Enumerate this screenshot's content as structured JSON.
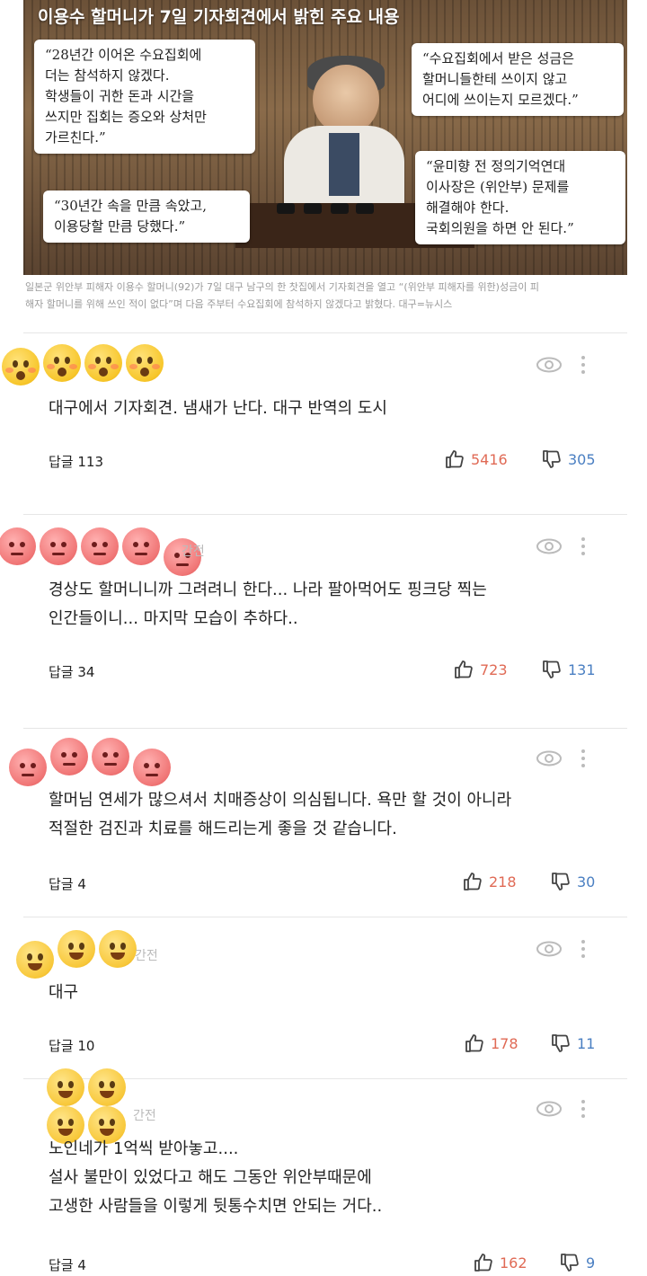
{
  "header": {
    "headline": "이용수 할머니가 7일 기자회견에서 밝힌 주요 내용",
    "quotes": [
      "“28년간 이어온 수요집회에\n더는 참석하지 않겠다.\n학생들이 귀한 돈과 시간을\n쓰지만 집회는 증오와 상처만\n가르친다.”",
      "“수요집회에서 받은 성금은\n할머니들한테 쓰이지 않고\n어디에 쓰이는지 모르겠다.”",
      "“30년간 속을 만큼 속았고,\n이용당할 만큼 당했다.”",
      "“윤미향 전 정의기억연대\n이사장은 (위안부) 문제를\n해결해야 한다.\n국회의원을 하면 안 된다.”"
    ],
    "caption": "일본군 위안부 피해자 이용수 할머니(92)가 7일 대구 남구의 한 찻집에서 기자회견을 열고 “(위안부 피해자를 위한)성금이 피\n해자 할머니를 위해 쓰인 적이 없다”며 다음 주부터 수요집회에 참석하지 않겠다고 밝혔다. 대구=뉴시스"
  },
  "comments": [
    {
      "emoji_kind": "shock-emoji",
      "time": "",
      "text": "대구에서 기자회견. 냄새가 난다. 대구 반역의 도시",
      "reply_label": "답글 113",
      "likes": "5416",
      "dislikes": "305"
    },
    {
      "emoji_kind": "angry-emoji",
      "time": "간전",
      "text": "경상도 할머니니까 그려려니 한다... 나라 팔아먹어도 핑크당 찍는\n인간들이니... 마지막 모습이 추하다..",
      "reply_label": "답글 34",
      "likes": "723",
      "dislikes": "131"
    },
    {
      "emoji_kind": "angry-emoji",
      "time": "",
      "text": "할머님 연세가 많으셔서 치매증상이 의심됩니다. 욕만 할 것이 아니라\n적절한 검진과 치료를 해드리는게 좋을 것 같습니다.",
      "reply_label": "답글 4",
      "likes": "218",
      "dislikes": "30"
    },
    {
      "emoji_kind": "tongue-emoji",
      "time": "간전",
      "text": "대구",
      "reply_label": "답글 10",
      "likes": "178",
      "dislikes": "11"
    },
    {
      "emoji_kind": "tongue-emoji",
      "time": "간전",
      "text": "노인네가 1억씩 받아놓고....\n설사 불만이 있었다고 해도 그동안 위안부때문에\n고생한 사람들을 이렇게 뒷통수치면 안되는 거다..",
      "reply_label": "답글 4",
      "likes": "162",
      "dislikes": "9"
    }
  ],
  "icons": {
    "view": "eye-icon",
    "more": "more-vertical-icon",
    "like": "thumbs-up-icon",
    "dislike": "thumbs-down-icon"
  },
  "colors": {
    "like": "#e06a55",
    "dislike": "#4a7fc2",
    "meta": "#bbbbbb"
  }
}
